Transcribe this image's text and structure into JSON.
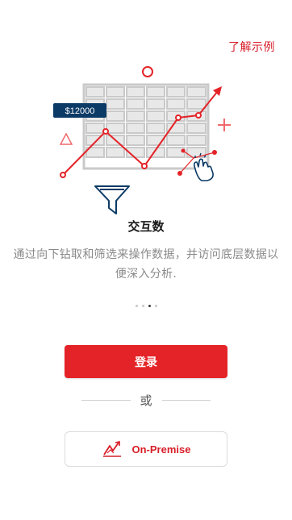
{
  "header": {
    "learn_link": "了解示例"
  },
  "illustration": {
    "price_label": "$12000",
    "icons": [
      "circle-icon",
      "triangle-icon",
      "plus-icon",
      "filter-funnel-icon",
      "tap-hand-icon",
      "trend-line-icon"
    ],
    "accent_color": "#e42328",
    "navy_color": "#0b3a66"
  },
  "slide": {
    "title": "交互数",
    "description": "通过向下钻取和筛选来操作数据，并访问底层数据以便深入分析."
  },
  "pager": {
    "count": 4,
    "active_index": 2
  },
  "actions": {
    "login_label": "登录",
    "or_label": "或",
    "onprem_label": "On-Premise",
    "onprem_icon": "trend-chart-icon"
  },
  "colors": {
    "primary": "#e42328",
    "link": "#d71e28",
    "muted_text": "#8a8a8a"
  }
}
